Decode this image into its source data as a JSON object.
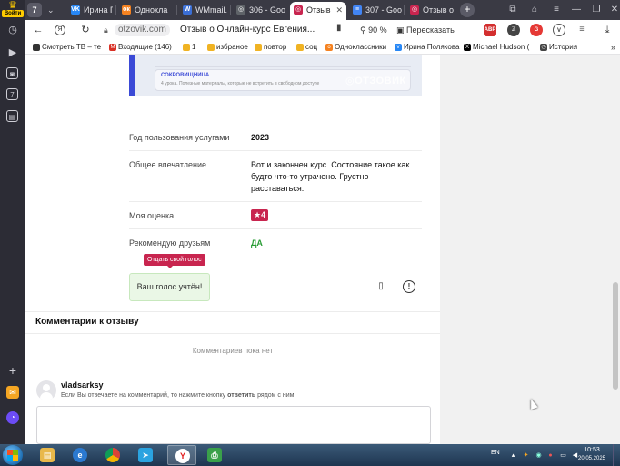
{
  "sidebar": {
    "logo_label": "Войти"
  },
  "tabs": {
    "counter": "7",
    "items": [
      {
        "label": "Ирина П",
        "fav_color": "#2787f5",
        "fav_glyph": "VK"
      },
      {
        "label": "Однокла",
        "fav_color": "#f58220",
        "fav_glyph": "ок"
      },
      {
        "label": "WMmail.",
        "fav_color": "#3b6fd6",
        "fav_glyph": "W"
      },
      {
        "label": "306 - Goo",
        "fav_color": "#5f6368",
        "fav_glyph": "◎"
      },
      {
        "label": "Отзыв",
        "fav_color": "#c8254f",
        "fav_glyph": "◎"
      },
      {
        "label": "307 - Goo",
        "fav_color": "#4285f4",
        "fav_glyph": "≡"
      },
      {
        "label": "Отзыв о",
        "fav_color": "#c8254f",
        "fav_glyph": "◎"
      }
    ]
  },
  "address": {
    "domain": "otzovik.com",
    "title": "Отзыв о Онлайн-курс Евгения...",
    "zoom": "90 %",
    "retell": "Пересказать",
    "extensions": [
      {
        "label": "ABP",
        "color": "#d32f2f"
      },
      {
        "label": "ℤ",
        "color": "#444444"
      },
      {
        "label": "G",
        "color": "#e53935"
      },
      {
        "label": "V",
        "color": "#555555"
      },
      {
        "label": "☰",
        "color": "#555555"
      }
    ]
  },
  "bookmarks": [
    {
      "label": "Смотреть ТВ – те",
      "color": "#333333",
      "glyph": "▪"
    },
    {
      "label": "Входящие (146)",
      "color": "#d93025",
      "glyph": "M"
    },
    {
      "label": "1",
      "color": "#f0b323",
      "glyph": "▪"
    },
    {
      "label": "избраное",
      "color": "#f0b323",
      "glyph": "▪"
    },
    {
      "label": "повтор",
      "color": "#f0b323",
      "glyph": "▪"
    },
    {
      "label": "соц",
      "color": "#f0b323",
      "glyph": "▪"
    },
    {
      "label": "Одноклассники",
      "color": "#f58220",
      "glyph": "ок"
    },
    {
      "label": "Ирина Полякова",
      "color": "#2787f5",
      "glyph": "VK"
    },
    {
      "label": "Michael Hudson (",
      "color": "#000000",
      "glyph": "X"
    },
    {
      "label": "История",
      "color": "#444444",
      "glyph": "◷"
    }
  ],
  "screenshot": {
    "card_title": "СОКРОВИЩНИЦА",
    "card_text": "4 урока. Полезные материалы, которые не встретить в свободном доступе",
    "watermark": "◎ОТЗОВИК"
  },
  "review": {
    "usage_year_label": "Год пользования услугами",
    "usage_year": "2023",
    "impression_label": "Общее впечатление",
    "impression": "Вот и закончен курс. Состояние такое как будто что-то утрачено. Грустно расставаться.",
    "rating_label": "Моя оценка",
    "rating_star": "★",
    "rating": "4",
    "recommend_label": "Рекомендую друзьям",
    "recommend": "ДА"
  },
  "vote": {
    "tooltip": "Отдать свой голос",
    "counted": "Ваш голос учтён!"
  },
  "comments": {
    "title": "Комментарии к отзыву",
    "empty": "Комментариев пока нет",
    "user": "vladsarksy",
    "hint_prefix": "Если Вы отвечаете на комментарий, то нажмите кнопку ",
    "hint_bold": "ответить",
    "hint_suffix": " рядом с ним",
    "input_value": ""
  },
  "taskbar": {
    "lang": "EN",
    "time": "10:53",
    "date": "20.05.2025",
    "apps": [
      {
        "name": "explorer",
        "color": "#e8b84a",
        "glyph": "▤"
      },
      {
        "name": "ie",
        "color": "#2b79d0",
        "glyph": "e"
      },
      {
        "name": "chrome",
        "color": "#dd4b39",
        "glyph": "●"
      },
      {
        "name": "telegram",
        "color": "#2aa3e0",
        "glyph": "➤"
      },
      {
        "name": "yandex",
        "color": "#e21d1d",
        "glyph": "Y"
      },
      {
        "name": "app",
        "color": "#3aa04a",
        "glyph": "⎙"
      }
    ]
  }
}
